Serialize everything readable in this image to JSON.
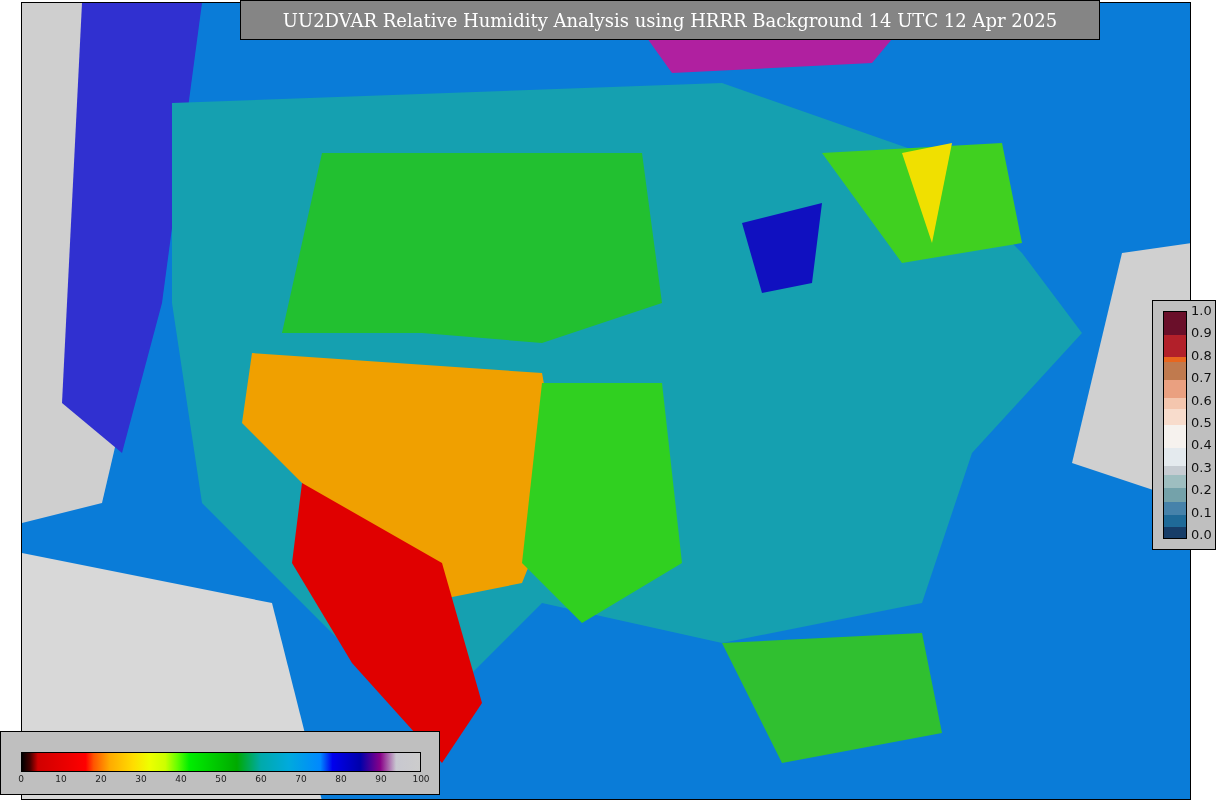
{
  "title": "UU2DVAR Relative Humidity Analysis using HRRR Background 14 UTC 12 Apr 2025",
  "humidity_scale": {
    "ticks": [
      "0",
      "10",
      "20",
      "30",
      "40",
      "50",
      "60",
      "70",
      "80",
      "90",
      "100"
    ]
  },
  "increment_scale": {
    "ticks": [
      "1.0",
      "0.9",
      "0.8",
      "0.7",
      "0.6",
      "0.5",
      "0.4",
      "0.3",
      "0.2",
      "0.1",
      "0.0"
    ]
  }
}
